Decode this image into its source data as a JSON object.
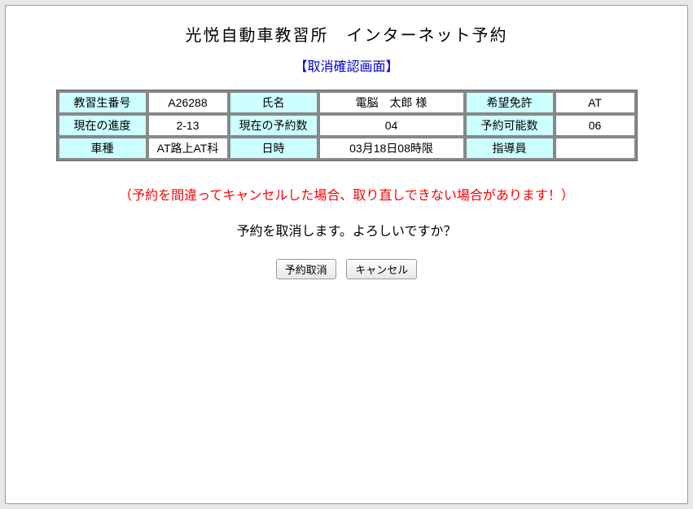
{
  "page": {
    "title": "光悦自動車教習所　インターネット予約",
    "screen_label": "【取消確認画面】"
  },
  "info": {
    "row1": {
      "label1": "教習生番号",
      "value1": "A26288",
      "label2": "氏名",
      "value2": "電脳　太郎 様",
      "label3": "希望免許",
      "value3": "AT"
    },
    "row2": {
      "label1": "現在の進度",
      "value1": "2-13",
      "label2": "現在の予約数",
      "value2": "04",
      "label3": "予約可能数",
      "value3": "06"
    },
    "row3": {
      "label1": "車種",
      "value1": "AT路上AT科",
      "label2": "日時",
      "value2": "03月18日08時限",
      "label3": "指導員",
      "value3": ""
    }
  },
  "messages": {
    "warning": "（予約を間違ってキャンセルした場合、取り直しできない場合があります！）",
    "confirm": "予約を取消します。よろしいですか？"
  },
  "buttons": {
    "cancel_reservation": "予約取消",
    "cancel": "キャンセル"
  }
}
